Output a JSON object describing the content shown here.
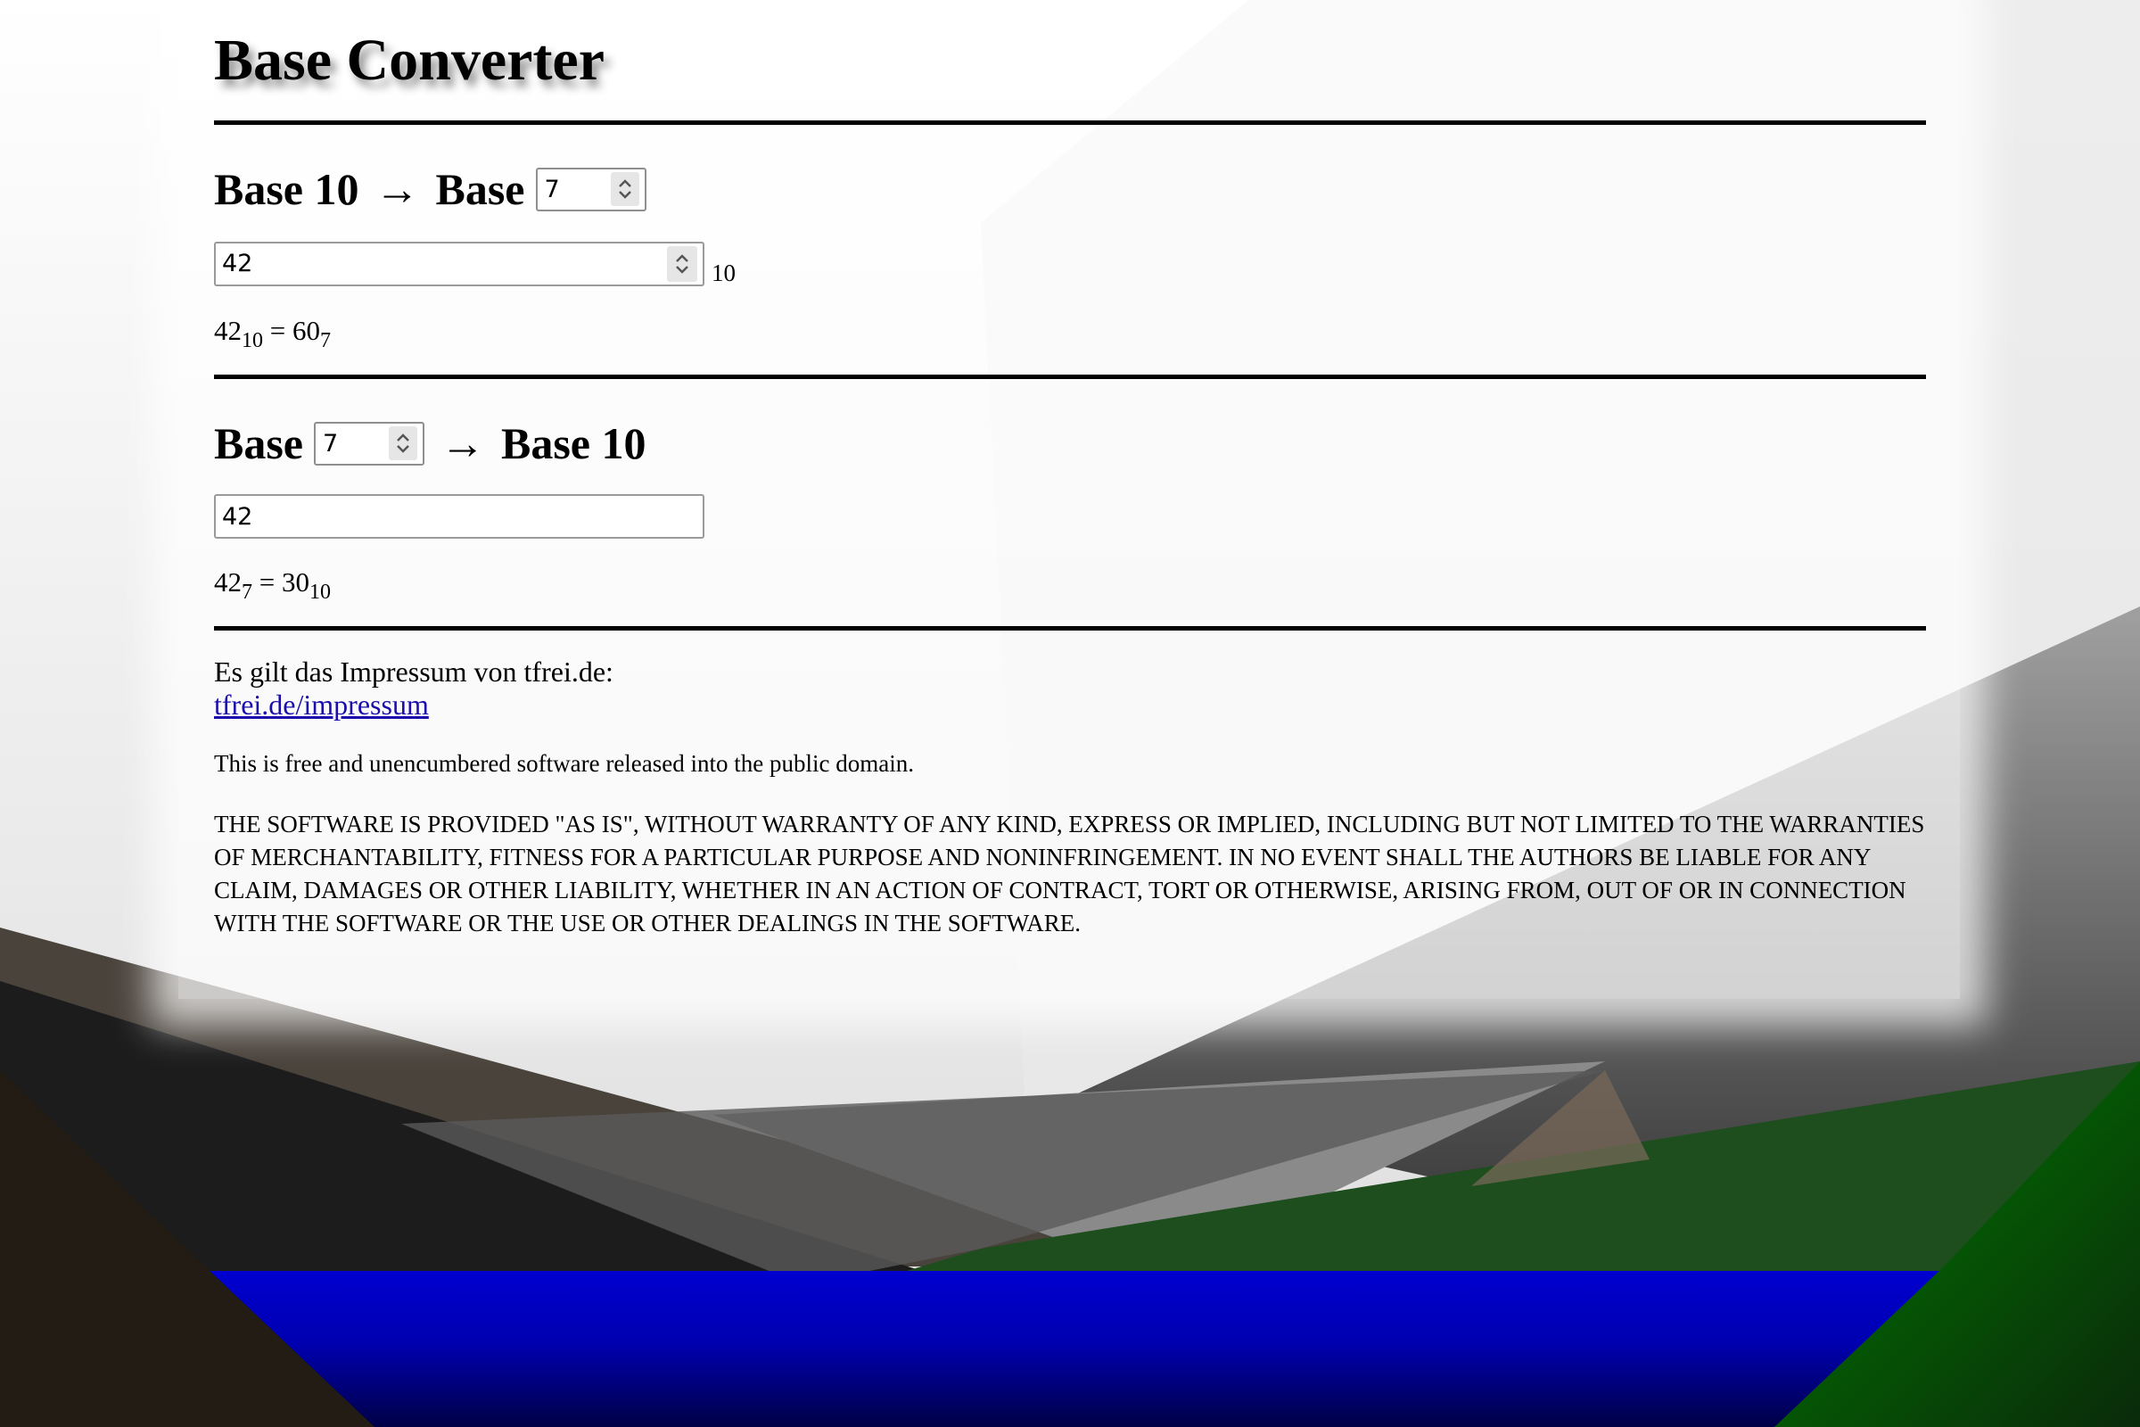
{
  "app": {
    "title": "Base Converter"
  },
  "to_base": {
    "heading_left": "Base 10",
    "arrow": "→",
    "heading_right": "Base",
    "target_base": "7",
    "input_value": "42",
    "input_suffix": "10",
    "result": {
      "input": "42",
      "input_base": "10",
      "equals": "=",
      "output": "60",
      "output_base": "7"
    }
  },
  "from_base": {
    "heading_left": "Base",
    "source_base": "7",
    "arrow": "→",
    "heading_right": "Base 10",
    "input_value": "42",
    "result": {
      "input": "42",
      "input_base": "7",
      "equals": "=",
      "output": "30",
      "output_base": "10"
    }
  },
  "footer": {
    "impressum_text": "Es gilt das Impressum von tfrei.de:",
    "impressum_link": "tfrei.de/impressum",
    "license_intro": "This is free and unencumbered software released into the public domain.",
    "license_warranty": "THE SOFTWARE IS PROVIDED \"AS IS\", WITHOUT WARRANTY OF ANY KIND, EXPRESS OR IMPLIED, INCLUDING BUT NOT LIMITED TO THE WARRANTIES OF MERCHANTABILITY, FITNESS FOR A PARTICULAR PURPOSE AND NONINFRINGEMENT. IN NO EVENT SHALL THE AUTHORS BE LIABLE FOR ANY CLAIM, DAMAGES OR OTHER LIABILITY, WHETHER IN AN ACTION OF CONTRACT, TORT OR OTHERWISE, ARISING FROM, OUT OF OR IN CONNECTION WITH THE SOFTWARE OR THE USE OR OTHER DEALINGS IN THE SOFTWARE."
  },
  "colors": {
    "link": "#1a0dab",
    "water": "#0000cc",
    "meadow": "#1e4d1e",
    "mountain_dark": "#1a1a1a"
  }
}
